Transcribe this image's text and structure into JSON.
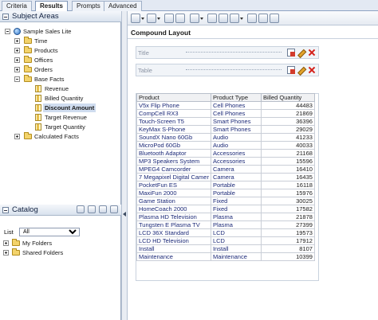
{
  "tabs": [
    "Criteria",
    "Results",
    "Prompts",
    "Advanced"
  ],
  "subject_areas": {
    "title": "Subject Areas",
    "root": "Sample Sales Lite",
    "folders": [
      "Time",
      "Products",
      "Offices",
      "Orders"
    ],
    "base_facts": {
      "label": "Base Facts",
      "columns": [
        "Revenue",
        "Billed Quantity",
        "Discount Amount",
        "Target Revenue",
        "Target Quantity"
      ],
      "selected": "Discount Amount"
    },
    "calculated_facts": "Calculated Facts"
  },
  "catalog": {
    "title": "Catalog",
    "list_label": "List",
    "list_value": "All",
    "folders": [
      "My Folders",
      "Shared Folders"
    ]
  },
  "layout": {
    "title": "Compound Layout",
    "views": [
      "Title",
      "Table"
    ]
  },
  "table": {
    "headers": [
      "Product",
      "Product Type",
      "Billed Quantity"
    ],
    "rows": [
      [
        "V5x Flip Phone",
        "Cell Phones",
        "44483"
      ],
      [
        "CompCell RX3",
        "Cell Phones",
        "21869"
      ],
      [
        "Touch-Screen T5",
        "Smart Phones",
        "36396"
      ],
      [
        "KeyMax S-Phone",
        "Smart Phones",
        "29029"
      ],
      [
        "SoundX Nano 60Gb",
        "Audio",
        "41233"
      ],
      [
        "MicroPod 60Gb",
        "Audio",
        "40033"
      ],
      [
        "Bluetooth Adaptor",
        "Accessories",
        "21168"
      ],
      [
        "MP3 Speakers System",
        "Accessories",
        "15596"
      ],
      [
        "MPEG4 Camcorder",
        "Camera",
        "16410"
      ],
      [
        "7 Megapixel Digital Camer",
        "Camera",
        "16435"
      ],
      [
        "PocketFun ES",
        "Portable",
        "16118"
      ],
      [
        "MaxiFun 2000",
        "Portable",
        "15976"
      ],
      [
        "Game Station",
        "Fixed",
        "30025"
      ],
      [
        "HomeCoach 2000",
        "Fixed",
        "17582"
      ],
      [
        "Plasma HD Television",
        "Plasma",
        "21878"
      ],
      [
        "Tungsten E Plasma TV",
        "Plasma",
        "27399"
      ],
      [
        "LCD 36X Standard",
        "LCD",
        "19573"
      ],
      [
        "LCD HD Television",
        "LCD",
        "17912"
      ],
      [
        "Install",
        "Install",
        "8107"
      ],
      [
        "Maintenance",
        "Maintenance",
        "10399"
      ]
    ]
  }
}
